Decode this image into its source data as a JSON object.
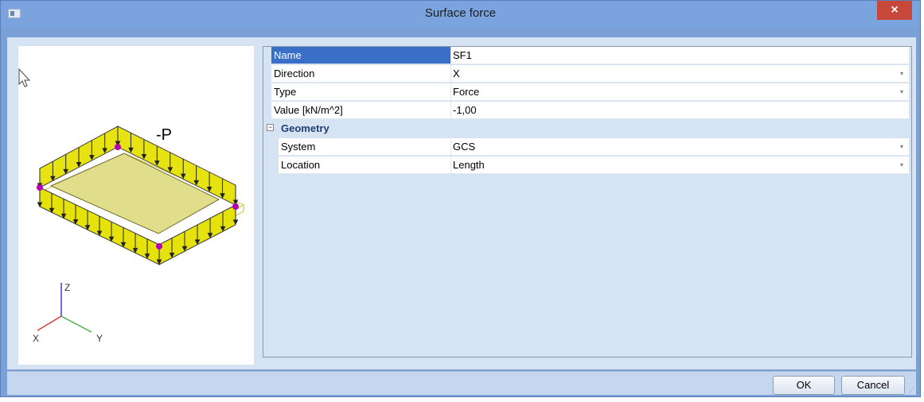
{
  "window": {
    "title": "Surface force",
    "close_glyph": "×"
  },
  "preview": {
    "load_label": "-P",
    "axes": {
      "x": "X",
      "y": "Y",
      "z": "Z"
    }
  },
  "properties": [
    {
      "name": "Name",
      "value": "SF1",
      "dropdown": false,
      "selected": true
    },
    {
      "name": "Direction",
      "value": "X",
      "dropdown": true
    },
    {
      "name": "Type",
      "value": "Force",
      "dropdown": true
    },
    {
      "name": "Value [kN/m^2]",
      "value": "-1,00",
      "dropdown": false
    }
  ],
  "geometry": {
    "label": "Geometry",
    "toggle": "−",
    "items": [
      {
        "name": "System",
        "value": "GCS",
        "dropdown": true
      },
      {
        "name": "Location",
        "value": "Length",
        "dropdown": true
      }
    ]
  },
  "buttons": {
    "ok": "OK",
    "cancel": "Cancel"
  },
  "colors": {
    "accent": "#3a6fc7",
    "load_fill": "#e5e100",
    "node": "#b400b4"
  }
}
